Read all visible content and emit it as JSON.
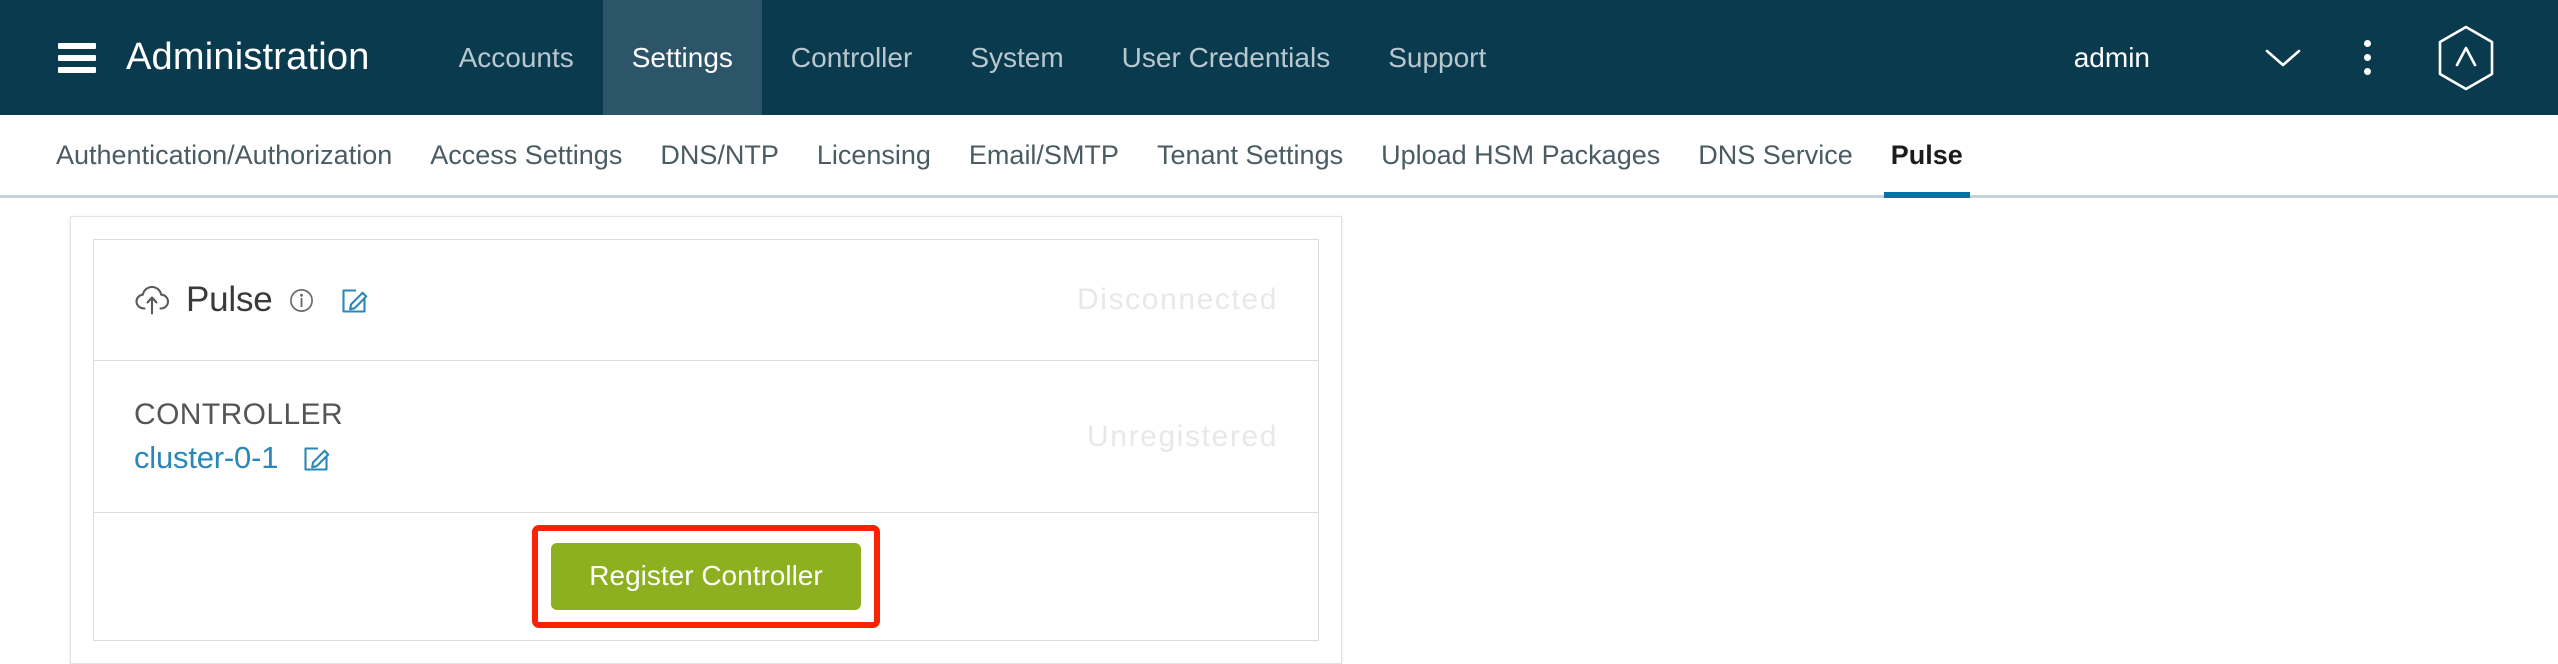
{
  "header": {
    "menu_icon": "hamburger-icon",
    "title": "Administration",
    "nav": [
      {
        "label": "Accounts",
        "active": false
      },
      {
        "label": "Settings",
        "active": true
      },
      {
        "label": "Controller",
        "active": false
      },
      {
        "label": "System",
        "active": false
      },
      {
        "label": "User Credentials",
        "active": false
      },
      {
        "label": "Support",
        "active": false
      }
    ],
    "user": "admin",
    "chevron_icon": "chevron-down-icon",
    "kebab_icon": "kebab-menu-icon",
    "logo_icon": "avi-hexagon-logo-icon",
    "background_color": "#0a3a4e",
    "active_tab_color": "#2d556a"
  },
  "subnav": {
    "items": [
      {
        "label": "Authentication/Authorization",
        "active": false
      },
      {
        "label": "Access Settings",
        "active": false
      },
      {
        "label": "DNS/NTP",
        "active": false
      },
      {
        "label": "Licensing",
        "active": false
      },
      {
        "label": "Email/SMTP",
        "active": false
      },
      {
        "label": "Tenant Settings",
        "active": false
      },
      {
        "label": "Upload HSM Packages",
        "active": false
      },
      {
        "label": "DNS Service",
        "active": false
      },
      {
        "label": "Pulse",
        "active": true
      }
    ],
    "active_underline_color": "#0b6fa4"
  },
  "pulse_card": {
    "header": {
      "cloud_icon": "cloud-upload-icon",
      "title": "Pulse",
      "info_icon": "info-circle-icon",
      "edit_icon": "edit-pencil-icon",
      "status": "Disconnected",
      "status_color": "#e8e8e8"
    },
    "controller": {
      "label": "CONTROLLER",
      "name": "cluster-0-1",
      "edit_icon": "edit-pencil-icon",
      "status": "Unregistered",
      "link_color": "#2a87b8"
    },
    "action": {
      "register_label": "Register Controller",
      "button_color": "#8db021",
      "highlight_color": "#fa2200"
    }
  }
}
